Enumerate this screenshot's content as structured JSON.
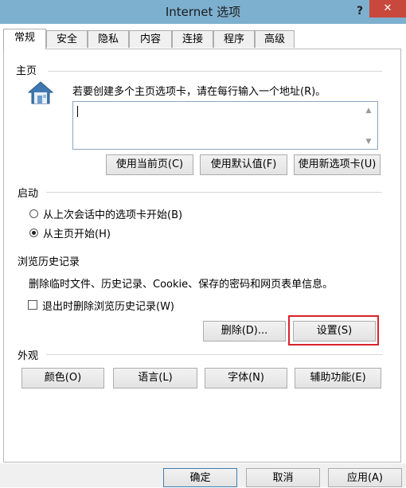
{
  "window": {
    "title": "Internet 选项",
    "help_label": "?",
    "close_label": "✕"
  },
  "tabs": [
    {
      "label": "常规",
      "active": true
    },
    {
      "label": "安全"
    },
    {
      "label": "隐私"
    },
    {
      "label": "内容"
    },
    {
      "label": "连接"
    },
    {
      "label": "程序"
    },
    {
      "label": "高级"
    }
  ],
  "home": {
    "heading": "主页",
    "instruction": "若要创建多个主页选项卡，请在每行输入一个地址(R)。",
    "value": "",
    "buttons": {
      "current": "使用当前页(C)",
      "default": "使用默认值(F)",
      "newtab": "使用新选项卡(U)"
    }
  },
  "startup": {
    "heading": "启动",
    "options": [
      {
        "label": "从上次会话中的选项卡开始(B)",
        "selected": false
      },
      {
        "label": "从主页开始(H)",
        "selected": true
      }
    ]
  },
  "history": {
    "heading": "浏览历史记录",
    "description": "删除临时文件、历史记录、Cookie、保存的密码和网页表单信息。",
    "checkbox_label": "退出时删除浏览历史记录(W)",
    "checkbox_checked": false,
    "delete_label": "删除(D)...",
    "settings_label": "设置(S)"
  },
  "appearance": {
    "heading": "外观",
    "buttons": {
      "colors": "颜色(O)",
      "languages": "语言(L)",
      "fonts": "字体(N)",
      "accessibility": "辅助功能(E)"
    }
  },
  "footer": {
    "ok": "确定",
    "cancel": "取消",
    "apply": "应用(A)"
  },
  "colors": {
    "titlebar": "#7db0cf",
    "close": "#c9483d",
    "highlight": "#d9232b"
  }
}
